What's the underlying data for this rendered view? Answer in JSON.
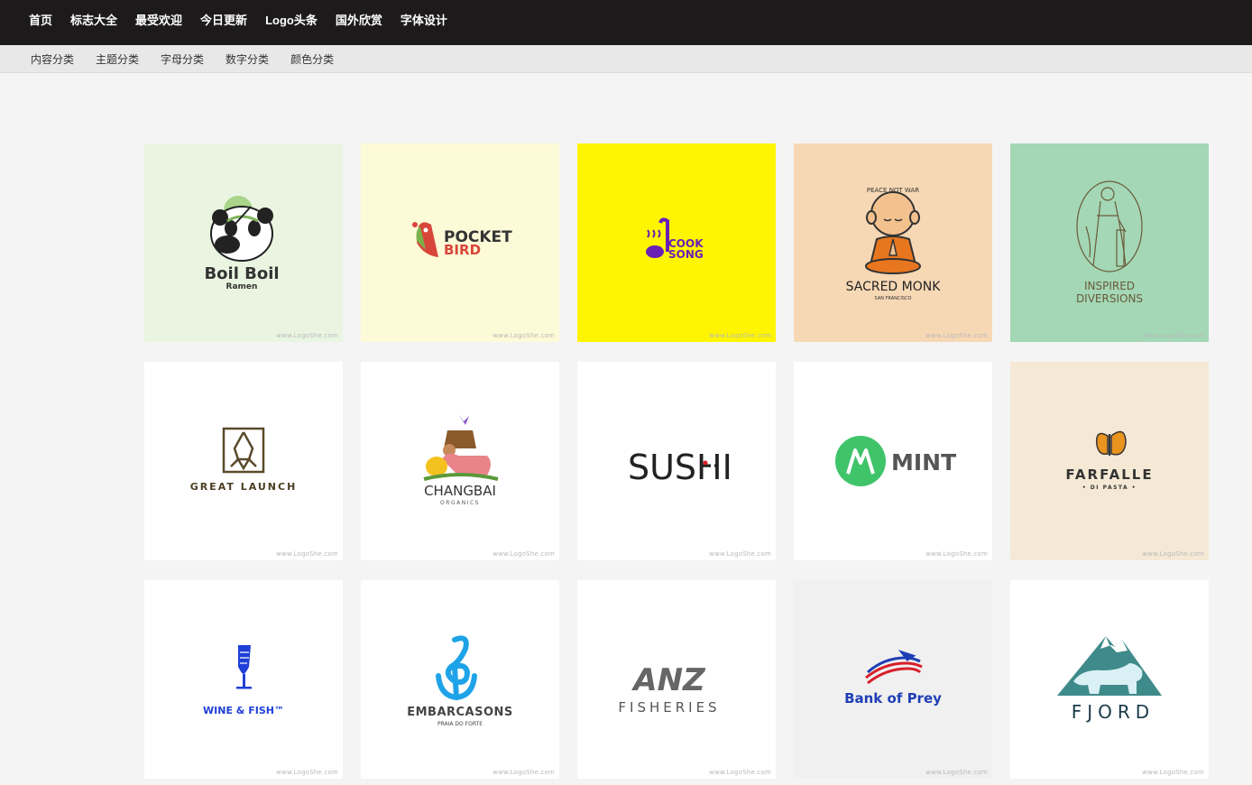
{
  "top_nav": [
    "首页",
    "标志大全",
    "最受欢迎",
    "今日更新",
    "Logo头条",
    "国外欣赏",
    "字体设计"
  ],
  "sub_nav": [
    "内容分类",
    "主题分类",
    "字母分类",
    "数字分类",
    "颜色分类"
  ],
  "watermark": "www.LogoShe.com",
  "colors": {
    "topbar": "#1c1a1a",
    "subbar": "#e8e8e8",
    "page": "#f4f4f4"
  },
  "logos": [
    {
      "bg": "#eaf5e1",
      "name": "Boil Boil",
      "sub": "Ramen",
      "icon": "panda-icon"
    },
    {
      "bg": "#fdfad7",
      "name": "POCKET",
      "name2": "BIRD",
      "icon": "bird-icon"
    },
    {
      "bg": "#fff500",
      "name": "COOK",
      "name2": "SONG",
      "icon": "music-note-icon"
    },
    {
      "bg": "#f7d8b5",
      "name": "SACRED MONK",
      "sub": "SAN FRANCISCO",
      "top": "PEACE NOT WAR",
      "icon": "monk-icon"
    },
    {
      "bg": "#a3d7b5",
      "name": "INSPIRED",
      "name2": "DIVERSIONS",
      "icon": "goddess-icon"
    },
    {
      "bg": "#ffffff",
      "name": "GREAT LAUNCH",
      "icon": "rocket-icon"
    },
    {
      "bg": "#ffffff",
      "name": "CHANGBAI",
      "sub": "ORGANICS",
      "icon": "animals-pyramid-icon"
    },
    {
      "bg": "#ffffff",
      "name": "SUSHI",
      "icon": "chopsticks-icon"
    },
    {
      "bg": "#ffffff",
      "name": "MINT",
      "icon": "mint-leaf-icon"
    },
    {
      "bg": "#f5e9d5",
      "name": "FARFALLE",
      "sub": "• DI PASTA •",
      "icon": "butterfly-icon"
    },
    {
      "bg": "#ffffff",
      "name": "WINE & FISH™",
      "icon": "wine-fish-icon"
    },
    {
      "bg": "#ffffff",
      "name": "EMBARCASONS",
      "sub": "PRAIA DO FORTE",
      "icon": "anchor-clef-icon"
    },
    {
      "bg": "#ffffff",
      "name": "FISHERIES",
      "mark": "ANZ",
      "icon": "anz-monogram-icon"
    },
    {
      "bg": "#f0f0f0",
      "name": "Bank of Prey",
      "icon": "eagle-flag-icon"
    },
    {
      "bg": "#ffffff",
      "name": "FJORD",
      "icon": "bear-mountain-icon"
    }
  ]
}
